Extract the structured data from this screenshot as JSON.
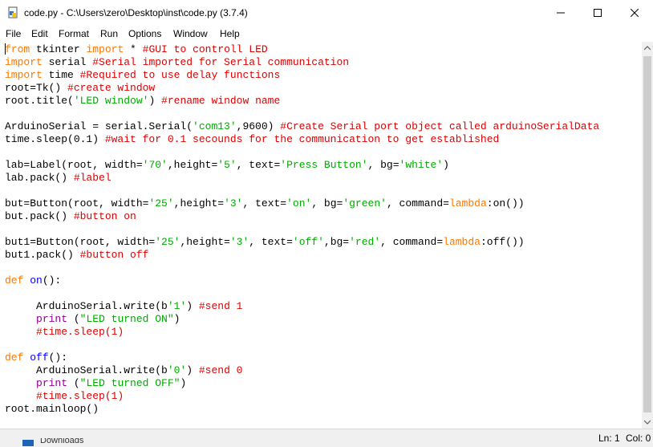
{
  "window": {
    "title": "code.py - C:\\Users\\zero\\Desktop\\inst\\code.py (3.7.4)",
    "minimize_glyph": "—",
    "maximize_glyph": "☐",
    "close_glyph": "✕"
  },
  "menu": {
    "items": [
      {
        "label": "File"
      },
      {
        "label": "Edit"
      },
      {
        "label": "Format"
      },
      {
        "label": "Run"
      },
      {
        "label": "Options"
      },
      {
        "label": "Window"
      },
      {
        "label": "Help"
      }
    ]
  },
  "colors": {
    "keyword": "#ff7700",
    "comment": "#dd0000",
    "string": "#00aa00",
    "builtin": "#900090",
    "definition": "#0000ff"
  },
  "code": {
    "lines": [
      [
        {
          "t": "kw",
          "v": "from"
        },
        {
          "t": "n",
          "v": " tkinter "
        },
        {
          "t": "kw",
          "v": "import"
        },
        {
          "t": "n",
          "v": " * "
        },
        {
          "t": "cm",
          "v": "#GUI to controll LED"
        }
      ],
      [
        {
          "t": "kw",
          "v": "import"
        },
        {
          "t": "n",
          "v": " serial "
        },
        {
          "t": "cm",
          "v": "#Serial imported for Serial communication"
        }
      ],
      [
        {
          "t": "kw",
          "v": "import"
        },
        {
          "t": "n",
          "v": " time "
        },
        {
          "t": "cm",
          "v": "#Required to use delay functions"
        }
      ],
      [
        {
          "t": "n",
          "v": "root=Tk() "
        },
        {
          "t": "cm",
          "v": "#create window"
        }
      ],
      [
        {
          "t": "n",
          "v": "root.title("
        },
        {
          "t": "st",
          "v": "'LED window'"
        },
        {
          "t": "n",
          "v": ") "
        },
        {
          "t": "cm",
          "v": "#rename window name"
        }
      ],
      [],
      [
        {
          "t": "n",
          "v": "ArduinoSerial = serial.Serial("
        },
        {
          "t": "st",
          "v": "'com13'"
        },
        {
          "t": "n",
          "v": ",9600) "
        },
        {
          "t": "cm",
          "v": "#Create Serial port object called arduinoSerialData"
        }
      ],
      [
        {
          "t": "n",
          "v": "time.sleep(0.1) "
        },
        {
          "t": "cm",
          "v": "#wait for 0.1 secounds for the communication to get established"
        }
      ],
      [],
      [
        {
          "t": "n",
          "v": "lab=Label(root, width="
        },
        {
          "t": "st",
          "v": "'70'"
        },
        {
          "t": "n",
          "v": ",height="
        },
        {
          "t": "st",
          "v": "'5'"
        },
        {
          "t": "n",
          "v": ", text="
        },
        {
          "t": "st",
          "v": "'Press Button'"
        },
        {
          "t": "n",
          "v": ", bg="
        },
        {
          "t": "st",
          "v": "'white'"
        },
        {
          "t": "n",
          "v": ")"
        }
      ],
      [
        {
          "t": "n",
          "v": "lab.pack() "
        },
        {
          "t": "cm",
          "v": "#label"
        }
      ],
      [],
      [
        {
          "t": "n",
          "v": "but=Button(root, width="
        },
        {
          "t": "st",
          "v": "'25'"
        },
        {
          "t": "n",
          "v": ",height="
        },
        {
          "t": "st",
          "v": "'3'"
        },
        {
          "t": "n",
          "v": ", text="
        },
        {
          "t": "st",
          "v": "'on'"
        },
        {
          "t": "n",
          "v": ", bg="
        },
        {
          "t": "st",
          "v": "'green'"
        },
        {
          "t": "n",
          "v": ", command="
        },
        {
          "t": "kw",
          "v": "lambda"
        },
        {
          "t": "n",
          "v": ":on())"
        }
      ],
      [
        {
          "t": "n",
          "v": "but.pack() "
        },
        {
          "t": "cm",
          "v": "#button on"
        }
      ],
      [],
      [
        {
          "t": "n",
          "v": "but1=Button(root, width="
        },
        {
          "t": "st",
          "v": "'25'"
        },
        {
          "t": "n",
          "v": ",height="
        },
        {
          "t": "st",
          "v": "'3'"
        },
        {
          "t": "n",
          "v": ", text="
        },
        {
          "t": "st",
          "v": "'off'"
        },
        {
          "t": "n",
          "v": ",bg="
        },
        {
          "t": "st",
          "v": "'red'"
        },
        {
          "t": "n",
          "v": ", command="
        },
        {
          "t": "kw",
          "v": "lambda"
        },
        {
          "t": "n",
          "v": ":off())"
        }
      ],
      [
        {
          "t": "n",
          "v": "but1.pack() "
        },
        {
          "t": "cm",
          "v": "#button off"
        }
      ],
      [],
      [
        {
          "t": "kw",
          "v": "def"
        },
        {
          "t": "n",
          "v": " "
        },
        {
          "t": "df",
          "v": "on"
        },
        {
          "t": "n",
          "v": "():"
        }
      ],
      [],
      [
        {
          "t": "n",
          "v": "     ArduinoSerial.write(b"
        },
        {
          "t": "st",
          "v": "'1'"
        },
        {
          "t": "n",
          "v": ") "
        },
        {
          "t": "cm",
          "v": "#send 1"
        }
      ],
      [
        {
          "t": "n",
          "v": "     "
        },
        {
          "t": "bi",
          "v": "print"
        },
        {
          "t": "n",
          "v": " ("
        },
        {
          "t": "st",
          "v": "\"LED turned ON\""
        },
        {
          "t": "n",
          "v": ")"
        }
      ],
      [
        {
          "t": "n",
          "v": "     "
        },
        {
          "t": "cm",
          "v": "#time.sleep(1)"
        }
      ],
      [],
      [
        {
          "t": "kw",
          "v": "def"
        },
        {
          "t": "n",
          "v": " "
        },
        {
          "t": "df",
          "v": "off"
        },
        {
          "t": "n",
          "v": "():"
        }
      ],
      [
        {
          "t": "n",
          "v": "     ArduinoSerial.write(b"
        },
        {
          "t": "st",
          "v": "'0'"
        },
        {
          "t": "n",
          "v": ") "
        },
        {
          "t": "cm",
          "v": "#send 0"
        }
      ],
      [
        {
          "t": "n",
          "v": "     "
        },
        {
          "t": "bi",
          "v": "print"
        },
        {
          "t": "n",
          "v": " ("
        },
        {
          "t": "st",
          "v": "\"LED turned OFF\""
        },
        {
          "t": "n",
          "v": ")"
        }
      ],
      [
        {
          "t": "n",
          "v": "     "
        },
        {
          "t": "cm",
          "v": "#time.sleep(1)"
        }
      ],
      [
        {
          "t": "n",
          "v": "root.mainloop()"
        }
      ]
    ]
  },
  "status": {
    "line": "Ln: 1",
    "col": "Col: 0"
  },
  "taskbar": {
    "peek_label": "Downloads"
  }
}
